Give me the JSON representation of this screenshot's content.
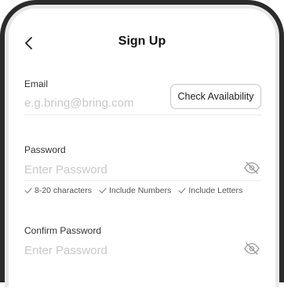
{
  "header": {
    "title": "Sign Up",
    "back_icon": "chevron-left-icon"
  },
  "email": {
    "label": "Email",
    "placeholder": "e.g.bring@bring.com",
    "value": "",
    "check_button": "Check Availability"
  },
  "password": {
    "label": "Password",
    "placeholder": "Enter Password",
    "value": "",
    "visibility_icon": "eye-off-icon",
    "rules": [
      {
        "icon": "check-icon",
        "text": "8-20 characters"
      },
      {
        "icon": "check-icon",
        "text": "Include Numbers"
      },
      {
        "icon": "check-icon",
        "text": "Include Letters"
      }
    ]
  },
  "confirm_password": {
    "label": "Confirm Password",
    "placeholder": "Enter Password",
    "value": "",
    "visibility_icon": "eye-off-icon"
  },
  "colors": {
    "frame": "#2b2b2b",
    "text": "#111111",
    "placeholder": "#c9c9c9",
    "divider": "#ececec",
    "muted": "#555555"
  }
}
